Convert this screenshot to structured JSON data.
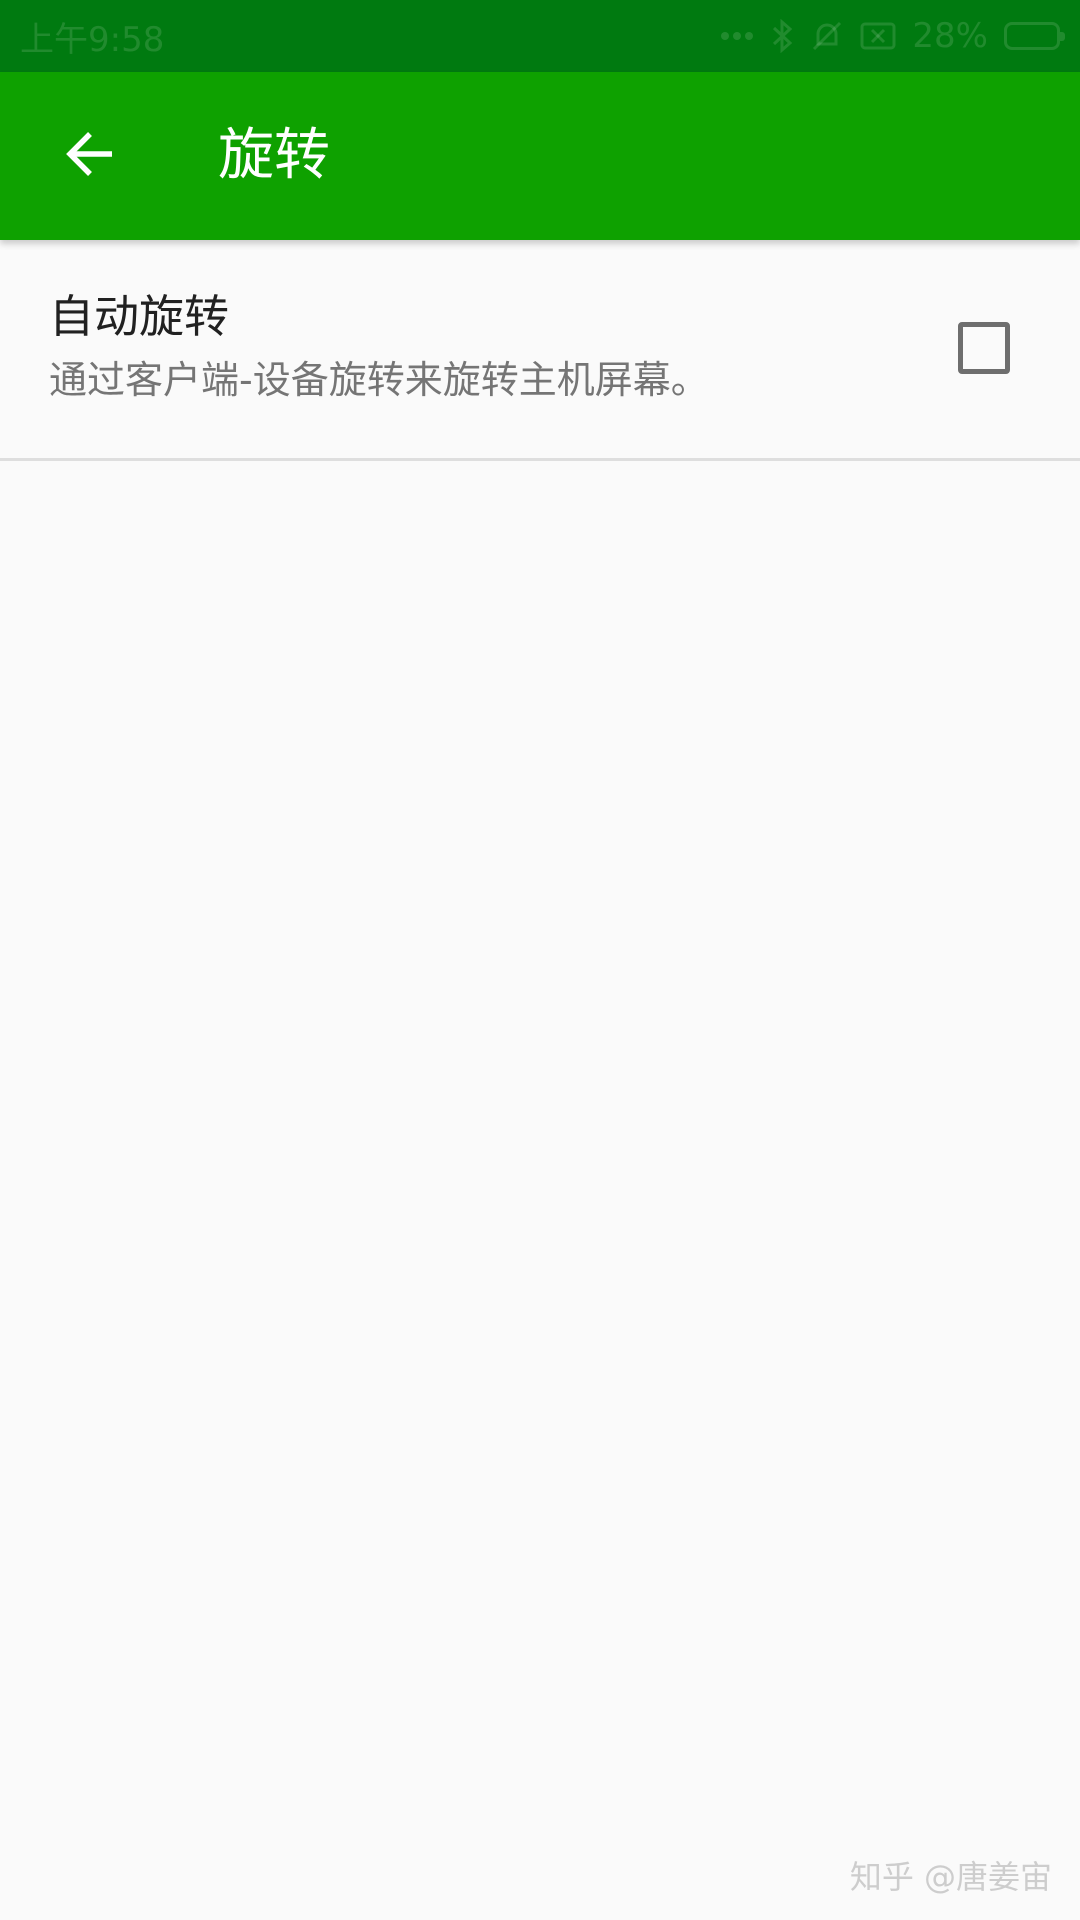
{
  "status_bar": {
    "time": "上午9:58",
    "battery_percent": "28%",
    "icons": [
      "more-dots-icon",
      "bluetooth-icon",
      "bell-muted-icon",
      "sim-disabled-icon",
      "battery-charging-icon"
    ]
  },
  "app_bar": {
    "title": "旋转",
    "back_icon": "arrow-left-icon",
    "background_color": "#0ea100",
    "status_color": "#007a10"
  },
  "preference": {
    "title": "自动旋转",
    "summary": "通过客户端-设备旋转来旋转主机屏幕。",
    "checked": false
  },
  "watermark": {
    "text": "知乎 @唐姜宙"
  }
}
